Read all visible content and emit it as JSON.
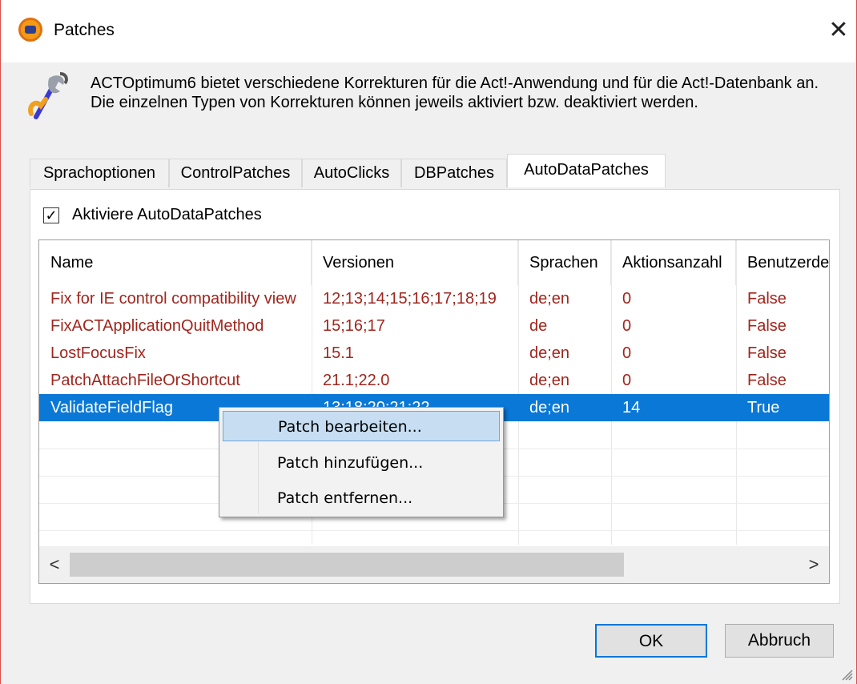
{
  "window": {
    "title": "Patches",
    "close_symbol": "✕"
  },
  "description": "ACTOptimum6 bietet verschiedene Korrekturen für die Act!-Anwendung und für die Act!-Datenbank an. Die einzelnen Typen von Korrekturen können jeweils aktiviert bzw. deaktiviert werden.",
  "tabs": [
    {
      "label": "Sprachoptionen"
    },
    {
      "label": "ControlPatches"
    },
    {
      "label": "AutoClicks"
    },
    {
      "label": "DBPatches"
    },
    {
      "label": "AutoDataPatches",
      "active": true
    }
  ],
  "panel": {
    "checkbox_label": "Aktiviere AutoDataPatches",
    "checkbox_checked": true,
    "check_mark": "✓"
  },
  "grid": {
    "columns": [
      "Name",
      "Versionen",
      "Sprachen",
      "Aktionsanzahl",
      "Benutzerde"
    ],
    "rows": [
      [
        "Fix for IE control compatibility view",
        "12;13;14;15;16;17;18;19",
        "de;en",
        "0",
        "False"
      ],
      [
        "FixACTApplicationQuitMethod",
        "15;16;17",
        "de",
        "0",
        "False"
      ],
      [
        "LostFocusFix",
        "15.1",
        "de;en",
        "0",
        "False"
      ],
      [
        "PatchAttachFileOrShortcut",
        "21.1;22.0",
        "de;en",
        "0",
        "False"
      ],
      [
        "ValidateFieldFlag",
        "13;18;20;21;22",
        "de;en",
        "14",
        "True"
      ]
    ],
    "selected_row": 4,
    "scroll_left": "<",
    "scroll_right": ">"
  },
  "context_menu": {
    "items": [
      "Patch bearbeiten...",
      "Patch hinzufügen...",
      "Patch entfernen..."
    ],
    "hovered": 0
  },
  "buttons": {
    "ok": "OK",
    "cancel": "Abbruch"
  },
  "colors": {
    "accent": "#0a78d7",
    "row_text": "#a0261e",
    "menu_hover": "#c7def2"
  }
}
